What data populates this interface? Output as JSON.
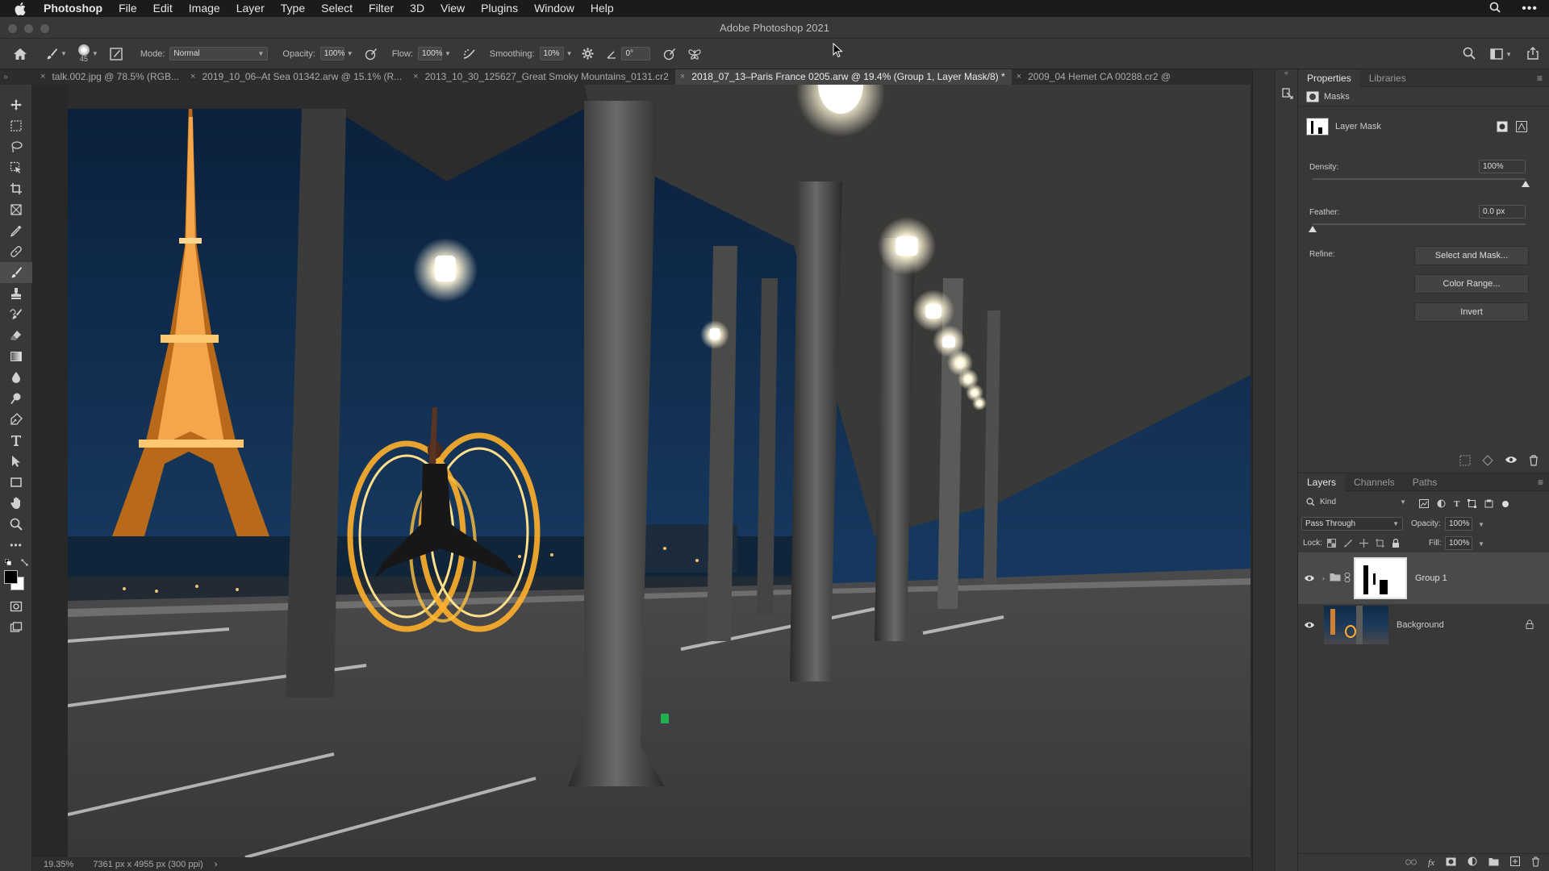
{
  "menubar": {
    "app": "Photoshop",
    "items": [
      "File",
      "Edit",
      "Image",
      "Layer",
      "Type",
      "Select",
      "Filter",
      "3D",
      "View",
      "Plugins",
      "Window",
      "Help"
    ]
  },
  "window": {
    "title": "Adobe Photoshop 2021"
  },
  "options": {
    "brush_size": "45",
    "mode_label": "Mode:",
    "mode_value": "Normal",
    "opacity_label": "Opacity:",
    "opacity_value": "100%",
    "flow_label": "Flow:",
    "flow_value": "100%",
    "smoothing_label": "Smoothing:",
    "smoothing_value": "10%",
    "angle_value": "0°"
  },
  "tabs": [
    {
      "label": "talk.002.jpg @ 78.5% (RGB..."
    },
    {
      "label": "2019_10_06–At Sea 01342.arw @ 15.1% (R..."
    },
    {
      "label": "2013_10_30_125627_Great Smoky Mountains_0131.cr2"
    },
    {
      "label": "2018_07_13–Paris France 0205.arw @ 19.4% (Group 1, Layer Mask/8) *"
    },
    {
      "label": "2009_04 Hemet CA 00288.cr2 @"
    }
  ],
  "status": {
    "zoom": "19.35%",
    "doc_info": "7361 px x 4955 px (300 ppi)"
  },
  "properties": {
    "tabs": [
      "Properties",
      "Libraries"
    ],
    "section": "Masks",
    "mask_type": "Layer Mask",
    "density_label": "Density:",
    "density_value": "100%",
    "density_fraction": 1.0,
    "feather_label": "Feather:",
    "feather_value": "0.0 px",
    "feather_fraction": 0.0,
    "refine_label": "Refine:",
    "buttons": {
      "select_and_mask": "Select and Mask...",
      "color_range": "Color Range...",
      "invert": "Invert"
    }
  },
  "layers_panel": {
    "tabs": [
      "Layers",
      "Channels",
      "Paths"
    ],
    "filter_kind": "Kind",
    "blend_mode": "Pass Through",
    "opacity_label": "Opacity:",
    "opacity_value": "100%",
    "lock_label": "Lock:",
    "fill_label": "Fill:",
    "fill_value": "100%",
    "layers": [
      {
        "name": "Group 1",
        "selected": true
      },
      {
        "name": "Background",
        "selected": false
      }
    ]
  }
}
